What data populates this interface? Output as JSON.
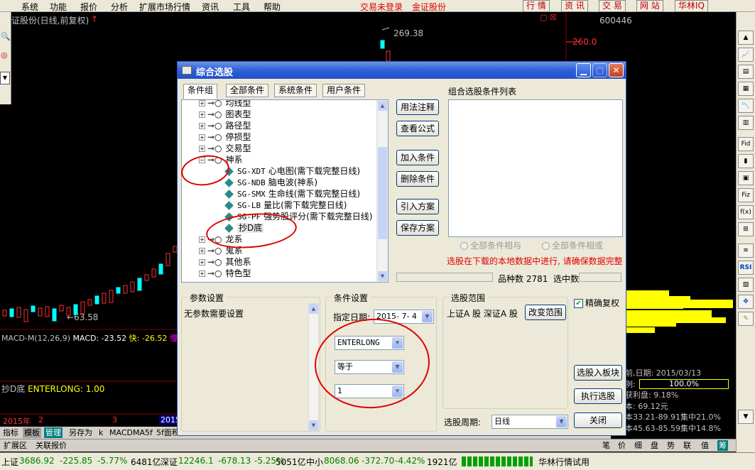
{
  "menu": {
    "items": [
      "系统",
      "功能",
      "报价",
      "分析",
      "扩展市场行情",
      "资讯",
      "工具",
      "帮助"
    ],
    "login_status": "交易未登录",
    "brand": "金证股份",
    "buttons": [
      "行 情",
      "资 讯",
      "交 易",
      "网 站",
      "华林IQ"
    ]
  },
  "chart": {
    "title": "证股份(日线,前复权)",
    "code": "600446",
    "price_high": "269.38",
    "price_axis_260": "260.0",
    "price_low": "←63.58",
    "macd_label": "MACD-M(12,26,9)",
    "macd_value": "MACD: -23.52",
    "macd_fast": "快: -26.52",
    "macd_slow": "慢",
    "indicator_line": "抄D底",
    "enterlong_label": "ENTERLONG: 1.00",
    "year_label": "2015年",
    "month_2": "2",
    "month_3": "3",
    "month_2015": "2015"
  },
  "right_info": {
    "date": "前,日期: 2015/03/13",
    "ratio_label": "例:",
    "ratio_value": "100.0%",
    "profit": "获利盘: 9.18%",
    "cost": "本: 69.12元",
    "conc1": "本33.21-89.91集中21.0%",
    "conc2": "本45.63-85.59集中14.8%"
  },
  "rail_buttons": [
    "RSI",
    "Fid",
    "Fiz",
    "f(x)"
  ],
  "bottom_tabs": [
    "指标",
    "模板",
    "管理",
    "另存为",
    "k",
    "MACD",
    "MA5f",
    "5f面积"
  ],
  "expand_row": {
    "left": [
      "扩展区",
      "关联报价"
    ],
    "right": [
      "笔",
      "价",
      "细",
      "盘",
      "势",
      "联",
      "值",
      "筹"
    ]
  },
  "status": {
    "sh_label": "上证",
    "sh_value": "3686.92",
    "sh_change": "-225.85",
    "sh_pct": "-5.77%",
    "sh_amount": "6481亿",
    "sz_label": "深证",
    "sz_value": "12246.1",
    "sz_change": "-678.13",
    "sz_pct": "-5.25%",
    "sz_amount": "5051亿",
    "zx_label": "中小",
    "zx_value": "8068.06",
    "zx_change": "-372.70",
    "zx_pct": "-4.42%",
    "zx_amount": "1921亿",
    "trial": "华林行情试用"
  },
  "dialog": {
    "title": "综合选股",
    "tabs": [
      "条件组",
      "全部条件",
      "系统条件",
      "用户条件"
    ],
    "tree": [
      {
        "type": "group",
        "label": "均线型"
      },
      {
        "type": "group",
        "label": "图表型"
      },
      {
        "type": "group",
        "label": "路径型"
      },
      {
        "type": "group",
        "label": "停损型"
      },
      {
        "type": "group",
        "label": "交易型"
      },
      {
        "type": "group_open",
        "label": "神系"
      },
      {
        "type": "leaf",
        "code": "SG-XDT",
        "label": "心电图(需下载完整日线)"
      },
      {
        "type": "leaf",
        "code": "SG-NDB",
        "label": "脑电波(神系)"
      },
      {
        "type": "leaf",
        "code": "SG-SMX",
        "label": "生命线(需下载完整日线)"
      },
      {
        "type": "leaf",
        "code": "SG-LB",
        "label": "量比(需下载完整日线)"
      },
      {
        "type": "leaf",
        "code": "SG-PF",
        "label": "强势股评分(需下载完整日线)"
      },
      {
        "type": "leaf",
        "code": "",
        "label": "抄D底"
      },
      {
        "type": "group",
        "label": "龙系"
      },
      {
        "type": "group",
        "label": "鬼系"
      },
      {
        "type": "group",
        "label": "其他系"
      },
      {
        "type": "group",
        "label": "特色型"
      }
    ],
    "buttons": {
      "usage": "用法注释",
      "view_formula": "查看公式",
      "add": "加入条件",
      "delete": "删除条件",
      "import": "引入方案",
      "save": "保存方案"
    },
    "list_title": "组合选股条件列表",
    "radio_and": "全部条件相与",
    "radio_or": "全部条件相或",
    "warning": "选股在下载的本地数据中进行, 请确保数据完整",
    "count_label": "品种数",
    "count_value": "2781",
    "selected_label": "选中数",
    "params_title": "参数设置",
    "params_text": "无参数需要设置",
    "cond_title": "条件设置",
    "date_label": "指定日期:",
    "date_value": "2015- 7- 4",
    "sel1": "ENTERLONG",
    "sel2": "等于",
    "sel3": "1",
    "range_title": "选股范围",
    "range_value": "上证A 股 深证A 股",
    "change_range": "改变范围",
    "exact_reweight": "精确复权",
    "to_board": "选股入板块",
    "execute": "执行选股",
    "period_label": "选股周期:",
    "period_value": "日线",
    "close": "关闭"
  },
  "colors": {
    "up": "#ff3030",
    "down": "#00ffff",
    "accent": "#2d5fd6",
    "warning": "#e00000"
  }
}
